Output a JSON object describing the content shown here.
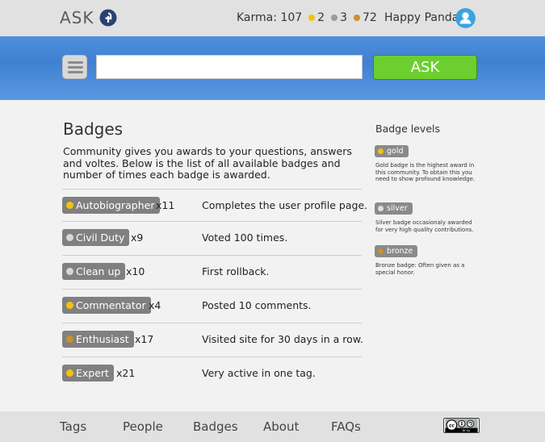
{
  "header": {
    "logo_text": "ASK",
    "karma_label": "Karma: 107",
    "gold_count": "2",
    "silver_count": "3",
    "bronze_count": "72",
    "username": "Happy Panda"
  },
  "search": {
    "placeholder": "",
    "ask_label": "ASK"
  },
  "main": {
    "title": "Badges",
    "intro": "Community gives you awards to your questions, answers and voltes. Below is the list of all available badges and number of times each badge is awarded.",
    "badges": [
      {
        "name": "Autobiographer",
        "count": "x11",
        "description": "Completes the user profile page.",
        "level": "gold"
      },
      {
        "name": "Civil Duty",
        "count": "x9",
        "description": "Voted 100 times.",
        "level": "silver"
      },
      {
        "name": "Clean up",
        "count": "x10",
        "description": "First rollback.",
        "level": "silver"
      },
      {
        "name": "Commentator",
        "count": "x4",
        "description": "Posted 10 comments.",
        "level": "gold"
      },
      {
        "name": "Enthusiast",
        "count": "x17",
        "description": "Visited site for 30 days in a row.",
        "level": "bronze"
      },
      {
        "name": "Expert",
        "count": "x21",
        "description": "Very active in one tag.",
        "level": "gold"
      }
    ]
  },
  "sidebar": {
    "title": "Badge levels",
    "levels": [
      {
        "label": "gold",
        "description": "Gold badge is the highest award in this community. To obtain this you need to show profound knowledge."
      },
      {
        "label": "silver",
        "description": "Silver badge occasionaly awarded for very high quality contributions."
      },
      {
        "label": "bronze",
        "description": "Bronze badge: Often given as a special honor."
      }
    ]
  },
  "footer": {
    "links": [
      "Tags",
      "People",
      "Badges",
      "About",
      "FAQs"
    ],
    "license_text": "BY SA"
  },
  "colors": {
    "gold": "#f4c20d",
    "silver": "#d6d6d6",
    "bronze": "#c8922d",
    "accent_green": "#6ccf2f",
    "band_blue": "#4f8fdc"
  }
}
